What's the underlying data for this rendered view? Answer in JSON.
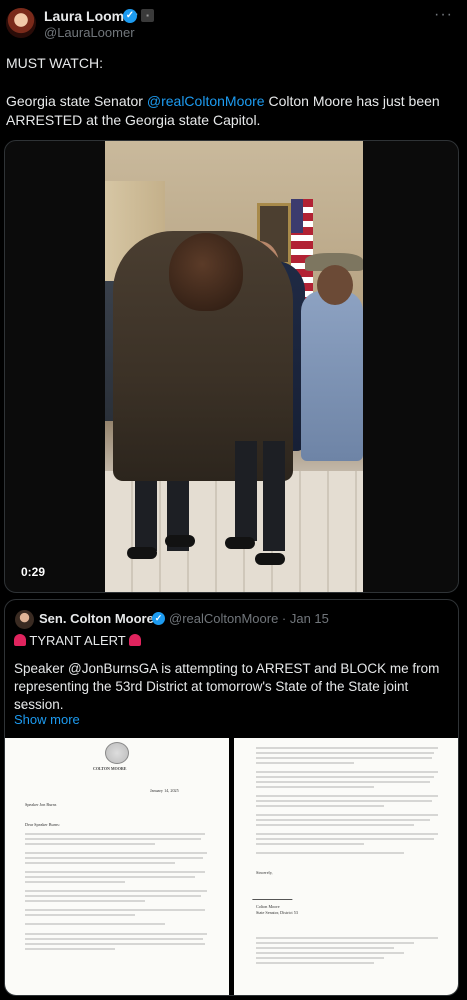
{
  "tweet": {
    "author_name": "Laura Loomer",
    "author_handle": "@LauraLoomer",
    "more_label": "···",
    "text_line1": "MUST WATCH:",
    "text_pre": "Georgia state Senator ",
    "mention": "@realColtonMoore",
    "text_post": " Colton Moore has just been ARRESTED at the Georgia state Capitol.",
    "video_timestamp": "0:29"
  },
  "quoted_tweet": {
    "author_name": "Sen. Colton Moore",
    "author_handle": "@realColtonMoore · Jan 15",
    "headline": "TYRANT ALERT",
    "body": "Speaker @JonBurnsGA is attempting to ARREST and BLOCK me from representing the 53rd District at tomorrow's State of the State joint session.",
    "ellipsis": "...",
    "show_more": "Show more",
    "doc_left": {
      "letterhead": "COLTON MOORE",
      "date": "January 14, 2025",
      "addressee": "Speaker Jon Burns",
      "salutation": "Dear Speaker Burns:"
    },
    "doc_right": {
      "closing": "Sincerely,",
      "signer": "Colton Moore",
      "signer_title": "State Senator, District 53"
    }
  },
  "colors": {
    "background": "#000000",
    "text": "#e7e9ea",
    "muted": "#71767b",
    "link": "#1d9bf0",
    "border": "#2f3336"
  }
}
